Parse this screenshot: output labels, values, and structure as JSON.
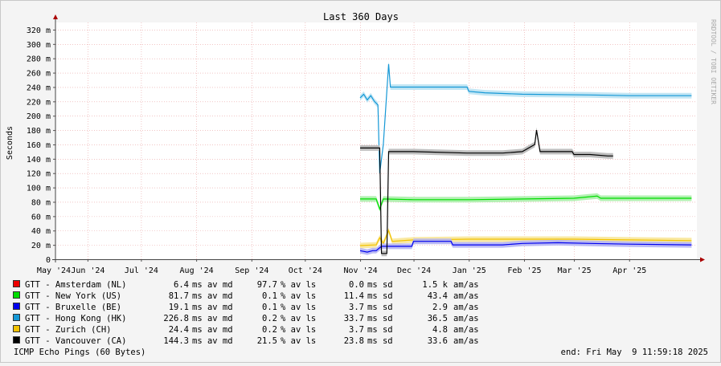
{
  "chart_data": {
    "type": "line",
    "title": "Last 360 Days",
    "ylabel": "Seconds",
    "watermark": "RRDTOOL / TOBI OETIKER",
    "ylim": [
      0,
      330
    ],
    "y_unit_suffix": "m",
    "y_ticks": [
      0,
      20,
      40,
      60,
      80,
      100,
      120,
      140,
      160,
      180,
      200,
      220,
      240,
      260,
      280,
      300,
      320
    ],
    "y_tick_labels": [
      "0",
      "20 m",
      "40 m",
      "60 m",
      "80 m",
      "100 m",
      "120 m",
      "140 m",
      "160 m",
      "180 m",
      "200 m",
      "220 m",
      "240 m",
      "260 m",
      "280 m",
      "300 m",
      "320 m"
    ],
    "x_domain": [
      "2024-05-14",
      "2025-05-09"
    ],
    "x_ticks": [
      {
        "date": "2024-05-01",
        "label": "May '24"
      },
      {
        "date": "2024-06-01",
        "label": "Jun '24"
      },
      {
        "date": "2024-07-01",
        "label": "Jul '24"
      },
      {
        "date": "2024-08-01",
        "label": "Aug '24"
      },
      {
        "date": "2024-09-01",
        "label": "Sep '24"
      },
      {
        "date": "2024-10-01",
        "label": "Oct '24"
      },
      {
        "date": "2024-11-01",
        "label": "Nov '24"
      },
      {
        "date": "2024-12-01",
        "label": "Dec '24"
      },
      {
        "date": "2025-01-01",
        "label": "Jan '25"
      },
      {
        "date": "2025-02-01",
        "label": "Feb '25"
      },
      {
        "date": "2025-03-01",
        "label": "Mar '25"
      },
      {
        "date": "2025-04-01",
        "label": "Apr '25"
      }
    ],
    "grid": true,
    "series": [
      {
        "name": "GTT - Amsterdam (NL)",
        "color": "#ee0000",
        "band": null,
        "points": []
      },
      {
        "name": "GTT - New York (US)",
        "color": "#00dd00",
        "band": "#aaf0aa",
        "points": [
          [
            "2024-11-01",
            84
          ],
          [
            "2024-11-10",
            84
          ],
          [
            "2024-11-12",
            70
          ],
          [
            "2024-11-14",
            84
          ],
          [
            "2024-12-01",
            83
          ],
          [
            "2025-01-01",
            83
          ],
          [
            "2025-02-01",
            84
          ],
          [
            "2025-03-01",
            85
          ],
          [
            "2025-03-14",
            88
          ],
          [
            "2025-03-16",
            85
          ],
          [
            "2025-04-01",
            85
          ],
          [
            "2025-05-06",
            85
          ]
        ]
      },
      {
        "name": "GTT - Bruxelle (BE)",
        "color": "#0000ee",
        "band": "#b4b4f4",
        "points": [
          [
            "2024-11-01",
            12
          ],
          [
            "2024-11-05",
            10
          ],
          [
            "2024-11-08",
            12
          ],
          [
            "2024-11-10",
            12
          ],
          [
            "2024-11-13",
            18
          ],
          [
            "2024-11-20",
            18
          ],
          [
            "2024-11-30",
            18
          ],
          [
            "2024-12-01",
            25
          ],
          [
            "2024-12-22",
            25
          ],
          [
            "2024-12-23",
            20
          ],
          [
            "2025-01-20",
            20
          ],
          [
            "2025-01-31",
            22
          ],
          [
            "2025-02-20",
            23
          ],
          [
            "2025-03-10",
            22
          ],
          [
            "2025-04-01",
            21
          ],
          [
            "2025-05-06",
            20
          ]
        ]
      },
      {
        "name": "GTT - Hong Kong (HK)",
        "color": "#1598d6",
        "band": "#bde3f3",
        "points": [
          [
            "2024-11-01",
            225
          ],
          [
            "2024-11-03",
            230
          ],
          [
            "2024-11-05",
            222
          ],
          [
            "2024-11-07",
            228
          ],
          [
            "2024-11-09",
            220
          ],
          [
            "2024-11-11",
            215
          ],
          [
            "2024-11-12",
            120
          ],
          [
            "2024-11-14",
            160
          ],
          [
            "2024-11-17",
            272
          ],
          [
            "2024-11-18",
            240
          ],
          [
            "2024-12-01",
            240
          ],
          [
            "2024-12-31",
            240
          ],
          [
            "2025-01-01",
            234
          ],
          [
            "2025-01-10",
            232
          ],
          [
            "2025-01-31",
            230
          ],
          [
            "2025-03-10",
            229
          ],
          [
            "2025-04-01",
            228
          ],
          [
            "2025-05-06",
            228
          ]
        ]
      },
      {
        "name": "GTT - Zurich (CH)",
        "color": "#f2c200",
        "band": "#f8e79a",
        "points": [
          [
            "2024-11-01",
            19
          ],
          [
            "2024-11-10",
            20
          ],
          [
            "2024-11-12",
            30
          ],
          [
            "2024-11-14",
            22
          ],
          [
            "2024-11-17",
            40
          ],
          [
            "2024-11-19",
            25
          ],
          [
            "2024-12-01",
            27
          ],
          [
            "2025-01-01",
            28
          ],
          [
            "2025-02-01",
            28
          ],
          [
            "2025-03-01",
            28
          ],
          [
            "2025-04-01",
            27
          ],
          [
            "2025-05-06",
            26
          ]
        ]
      },
      {
        "name": "GTT - Vancouver (CA)",
        "color": "#000000",
        "band": "#b8b8b8",
        "points": [
          [
            "2024-11-01",
            155
          ],
          [
            "2024-11-10",
            155
          ],
          [
            "2024-11-12",
            155
          ],
          [
            "2024-11-13",
            8
          ],
          [
            "2024-11-16",
            8
          ],
          [
            "2024-11-17",
            150
          ],
          [
            "2024-11-25",
            150
          ],
          [
            "2024-12-01",
            150
          ],
          [
            "2024-12-31",
            148
          ],
          [
            "2025-01-20",
            148
          ],
          [
            "2025-01-31",
            150
          ],
          [
            "2025-02-07",
            160
          ],
          [
            "2025-02-08",
            180
          ],
          [
            "2025-02-10",
            150
          ],
          [
            "2025-02-28",
            150
          ],
          [
            "2025-03-01",
            146
          ],
          [
            "2025-03-10",
            146
          ],
          [
            "2025-03-20",
            144
          ],
          [
            "2025-03-23",
            144
          ]
        ]
      }
    ]
  },
  "legend": {
    "rows": [
      {
        "name": "GTT - Amsterdam (NL)",
        "color": "#ee0000",
        "avg": "6.4",
        "avg_unit": "ms av md",
        "loss": "97.7",
        "loss_unit": "% av ls",
        "sd": "0.0",
        "sd_unit": "ms sd",
        "amas": "1.5 k",
        "amas_unit": "am/as"
      },
      {
        "name": "GTT - New York (US)",
        "color": "#00dd00",
        "avg": "81.7",
        "avg_unit": "ms av md",
        "loss": "0.1",
        "loss_unit": "% av ls",
        "sd": "11.4",
        "sd_unit": "ms sd",
        "amas": "43.4",
        "amas_unit": "am/as"
      },
      {
        "name": "GTT - Bruxelle (BE)",
        "color": "#0000ee",
        "avg": "19.1",
        "avg_unit": "ms av md",
        "loss": "0.1",
        "loss_unit": "% av ls",
        "sd": "3.7",
        "sd_unit": "ms sd",
        "amas": "2.9",
        "amas_unit": "am/as"
      },
      {
        "name": "GTT - Hong Kong (HK)",
        "color": "#1598d6",
        "avg": "226.8",
        "avg_unit": "ms av md",
        "loss": "0.2",
        "loss_unit": "% av ls",
        "sd": "33.7",
        "sd_unit": "ms sd",
        "amas": "36.5",
        "amas_unit": "am/as"
      },
      {
        "name": "GTT - Zurich (CH)",
        "color": "#f2c200",
        "avg": "24.4",
        "avg_unit": "ms av md",
        "loss": "0.2",
        "loss_unit": "% av ls",
        "sd": "3.7",
        "sd_unit": "ms sd",
        "amas": "4.8",
        "amas_unit": "am/as"
      },
      {
        "name": "GTT - Vancouver (CA)",
        "color": "#000000",
        "avg": "144.3",
        "avg_unit": "ms av md",
        "loss": "21.5",
        "loss_unit": "% av ls",
        "sd": "23.8",
        "sd_unit": "ms sd",
        "amas": "33.6",
        "amas_unit": "am/as"
      }
    ]
  },
  "footer": {
    "probe": "ICMP Echo Pings (60 Bytes)",
    "end_time": "end: Fri May  9 11:59:18 2025"
  }
}
